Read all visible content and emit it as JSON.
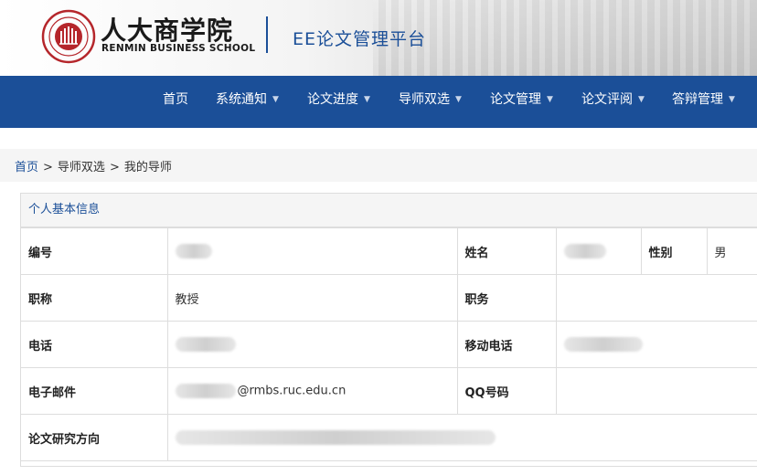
{
  "brand": {
    "name_cn": "人大商学院",
    "name_en": "RENMIN BUSINESS SCHOOL",
    "platform_title": "EE论文管理平台",
    "seal_color": "#b5262b"
  },
  "nav": {
    "items": [
      {
        "label": "首页",
        "has_dropdown": false
      },
      {
        "label": "系统通知",
        "has_dropdown": true
      },
      {
        "label": "论文进度",
        "has_dropdown": true
      },
      {
        "label": "导师双选",
        "has_dropdown": true
      },
      {
        "label": "论文管理",
        "has_dropdown": true
      },
      {
        "label": "论文评阅",
        "has_dropdown": true
      },
      {
        "label": "答辩管理",
        "has_dropdown": true
      }
    ],
    "bg_color": "#1b4f98"
  },
  "breadcrumb": {
    "home": "首页",
    "separator": ">",
    "section": "导师双选",
    "current": "我的导师"
  },
  "panel": {
    "title": "个人基本信息",
    "rows": [
      {
        "l1": "编号",
        "v1": "",
        "l2": "姓名",
        "v2": "",
        "l3": "性别",
        "v3": "男"
      },
      {
        "l1": "职称",
        "v1": "教授",
        "l2": "职务",
        "v2": ""
      },
      {
        "l1": "电话",
        "v1": "",
        "l2": "移动电话",
        "v2": ""
      },
      {
        "l1": "电子邮件",
        "v1": "@rmbs.ruc.edu.cn",
        "l2": "QQ号码",
        "v2": ""
      },
      {
        "l1": "论文研究方向",
        "v1": ""
      }
    ]
  }
}
